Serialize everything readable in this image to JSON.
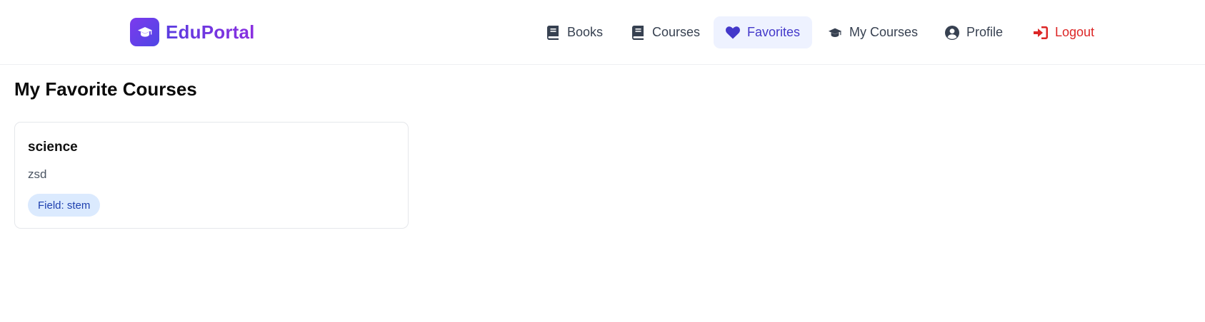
{
  "brand": {
    "name": "EduPortal",
    "logo_icon": "graduation-cap-icon",
    "gradient": [
      "#7c3aed",
      "#4f46e5"
    ]
  },
  "nav": {
    "items": [
      {
        "label": "Books",
        "icon": "book-icon"
      },
      {
        "label": "Courses",
        "icon": "book-icon"
      },
      {
        "label": "Favorites",
        "icon": "heart-icon",
        "active": true
      },
      {
        "label": "My Courses",
        "icon": "graduation-cap-icon"
      },
      {
        "label": "Profile",
        "icon": "user-circle-icon"
      },
      {
        "label": "Logout",
        "icon": "sign-in-icon",
        "color": "#dc2626"
      }
    ]
  },
  "main": {
    "title": "My Favorite Courses",
    "courses": [
      {
        "title": "science",
        "description": "zsd",
        "field_badge": "Field: stem"
      }
    ]
  },
  "colors": {
    "accent": "#4338ca",
    "active_bg": "#eef2ff",
    "badge_bg": "#dbeafe",
    "badge_text": "#1e40af",
    "logout": "#dc2626"
  }
}
